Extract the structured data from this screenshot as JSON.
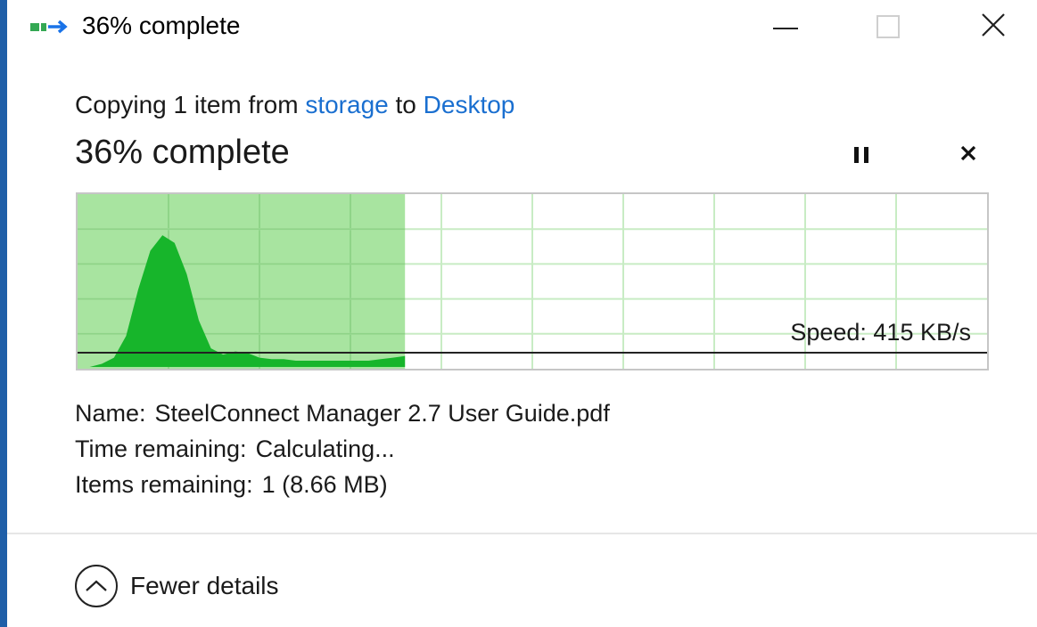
{
  "window": {
    "title": "36% complete",
    "icon": "copy-transfer-icon"
  },
  "controls": {
    "minimize_icon": "minimize-icon",
    "maximize_icon": "maximize-icon",
    "close_icon": "close-icon"
  },
  "operation": {
    "prefix": "Copying 1 item from ",
    "source": "storage",
    "middle": " to ",
    "destination": "Desktop",
    "percent_text": "36% complete",
    "progress_fraction": 0.36,
    "pause_icon": "pause-icon",
    "cancel_icon": "cancel-icon"
  },
  "graph": {
    "speed_text": "Speed: 415 KB/s",
    "fill_color": "#a8e4a0",
    "grid_color": "#c8ecc4",
    "speed_color": "#17b52b",
    "speed_samples": [
      0,
      0,
      2,
      6,
      20,
      50,
      75,
      85,
      80,
      60,
      30,
      12,
      8,
      10,
      9,
      6,
      5,
      5,
      4,
      4,
      4,
      4,
      4,
      4,
      4,
      5,
      6,
      7
    ]
  },
  "details": {
    "name_label": "Name:",
    "name_value": "SteelConnect Manager 2.7 User Guide.pdf",
    "time_label": "Time remaining:",
    "time_value": "Calculating...",
    "items_label": "Items remaining:",
    "items_value": "1 (8.66 MB)"
  },
  "footer": {
    "toggle_label": "Fewer details",
    "toggle_icon": "chevron-up-icon"
  }
}
